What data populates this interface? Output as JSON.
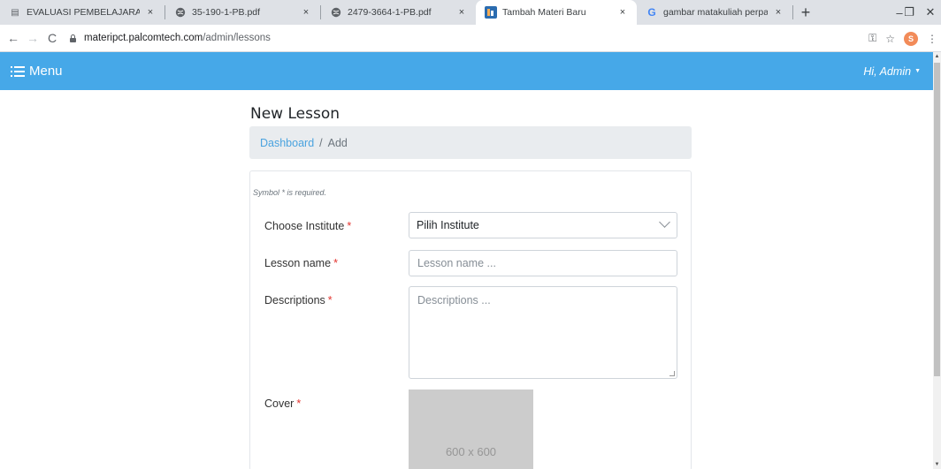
{
  "browser": {
    "tabs": [
      {
        "favicon": "document-icon",
        "title": "EVALUASI PEMBELAJARAN MA",
        "close": "×"
      },
      {
        "favicon": "globe-icon",
        "title": "35-190-1-PB.pdf",
        "close": "×"
      },
      {
        "favicon": "globe-icon",
        "title": "2479-3664-1-PB.pdf",
        "close": "×"
      },
      {
        "favicon": "app-icon",
        "title": "Tambah Materi Baru",
        "close": "×",
        "active": true
      },
      {
        "favicon": "google-icon",
        "title": "gambar matakuliah perpajaka",
        "close": "×"
      }
    ],
    "new_tab": "+",
    "url_host": "materipct.palcomtech.com",
    "url_path": "/admin/lessons",
    "profile_initial": "S"
  },
  "header": {
    "menu_label": "Menu",
    "greeting": "Hi, Admin"
  },
  "page": {
    "title": "New Lesson",
    "breadcrumb": {
      "link": "Dashboard",
      "separator": "/",
      "current": "Add"
    },
    "required_note": "Symbol * is required.",
    "fields": {
      "institute": {
        "label": "Choose Institute",
        "required": "*",
        "value": "Pilih Institute"
      },
      "lesson_name": {
        "label": "Lesson name",
        "required": "*",
        "placeholder": "Lesson name ..."
      },
      "descriptions": {
        "label": "Descriptions",
        "required": "*",
        "placeholder": "Descriptions ..."
      },
      "cover": {
        "label": "Cover",
        "required": "*",
        "placeholder_image": "600 x 600"
      }
    }
  },
  "colors": {
    "appbar": "#46a8e8",
    "link": "#4aa3df",
    "required": "#e3342f"
  }
}
